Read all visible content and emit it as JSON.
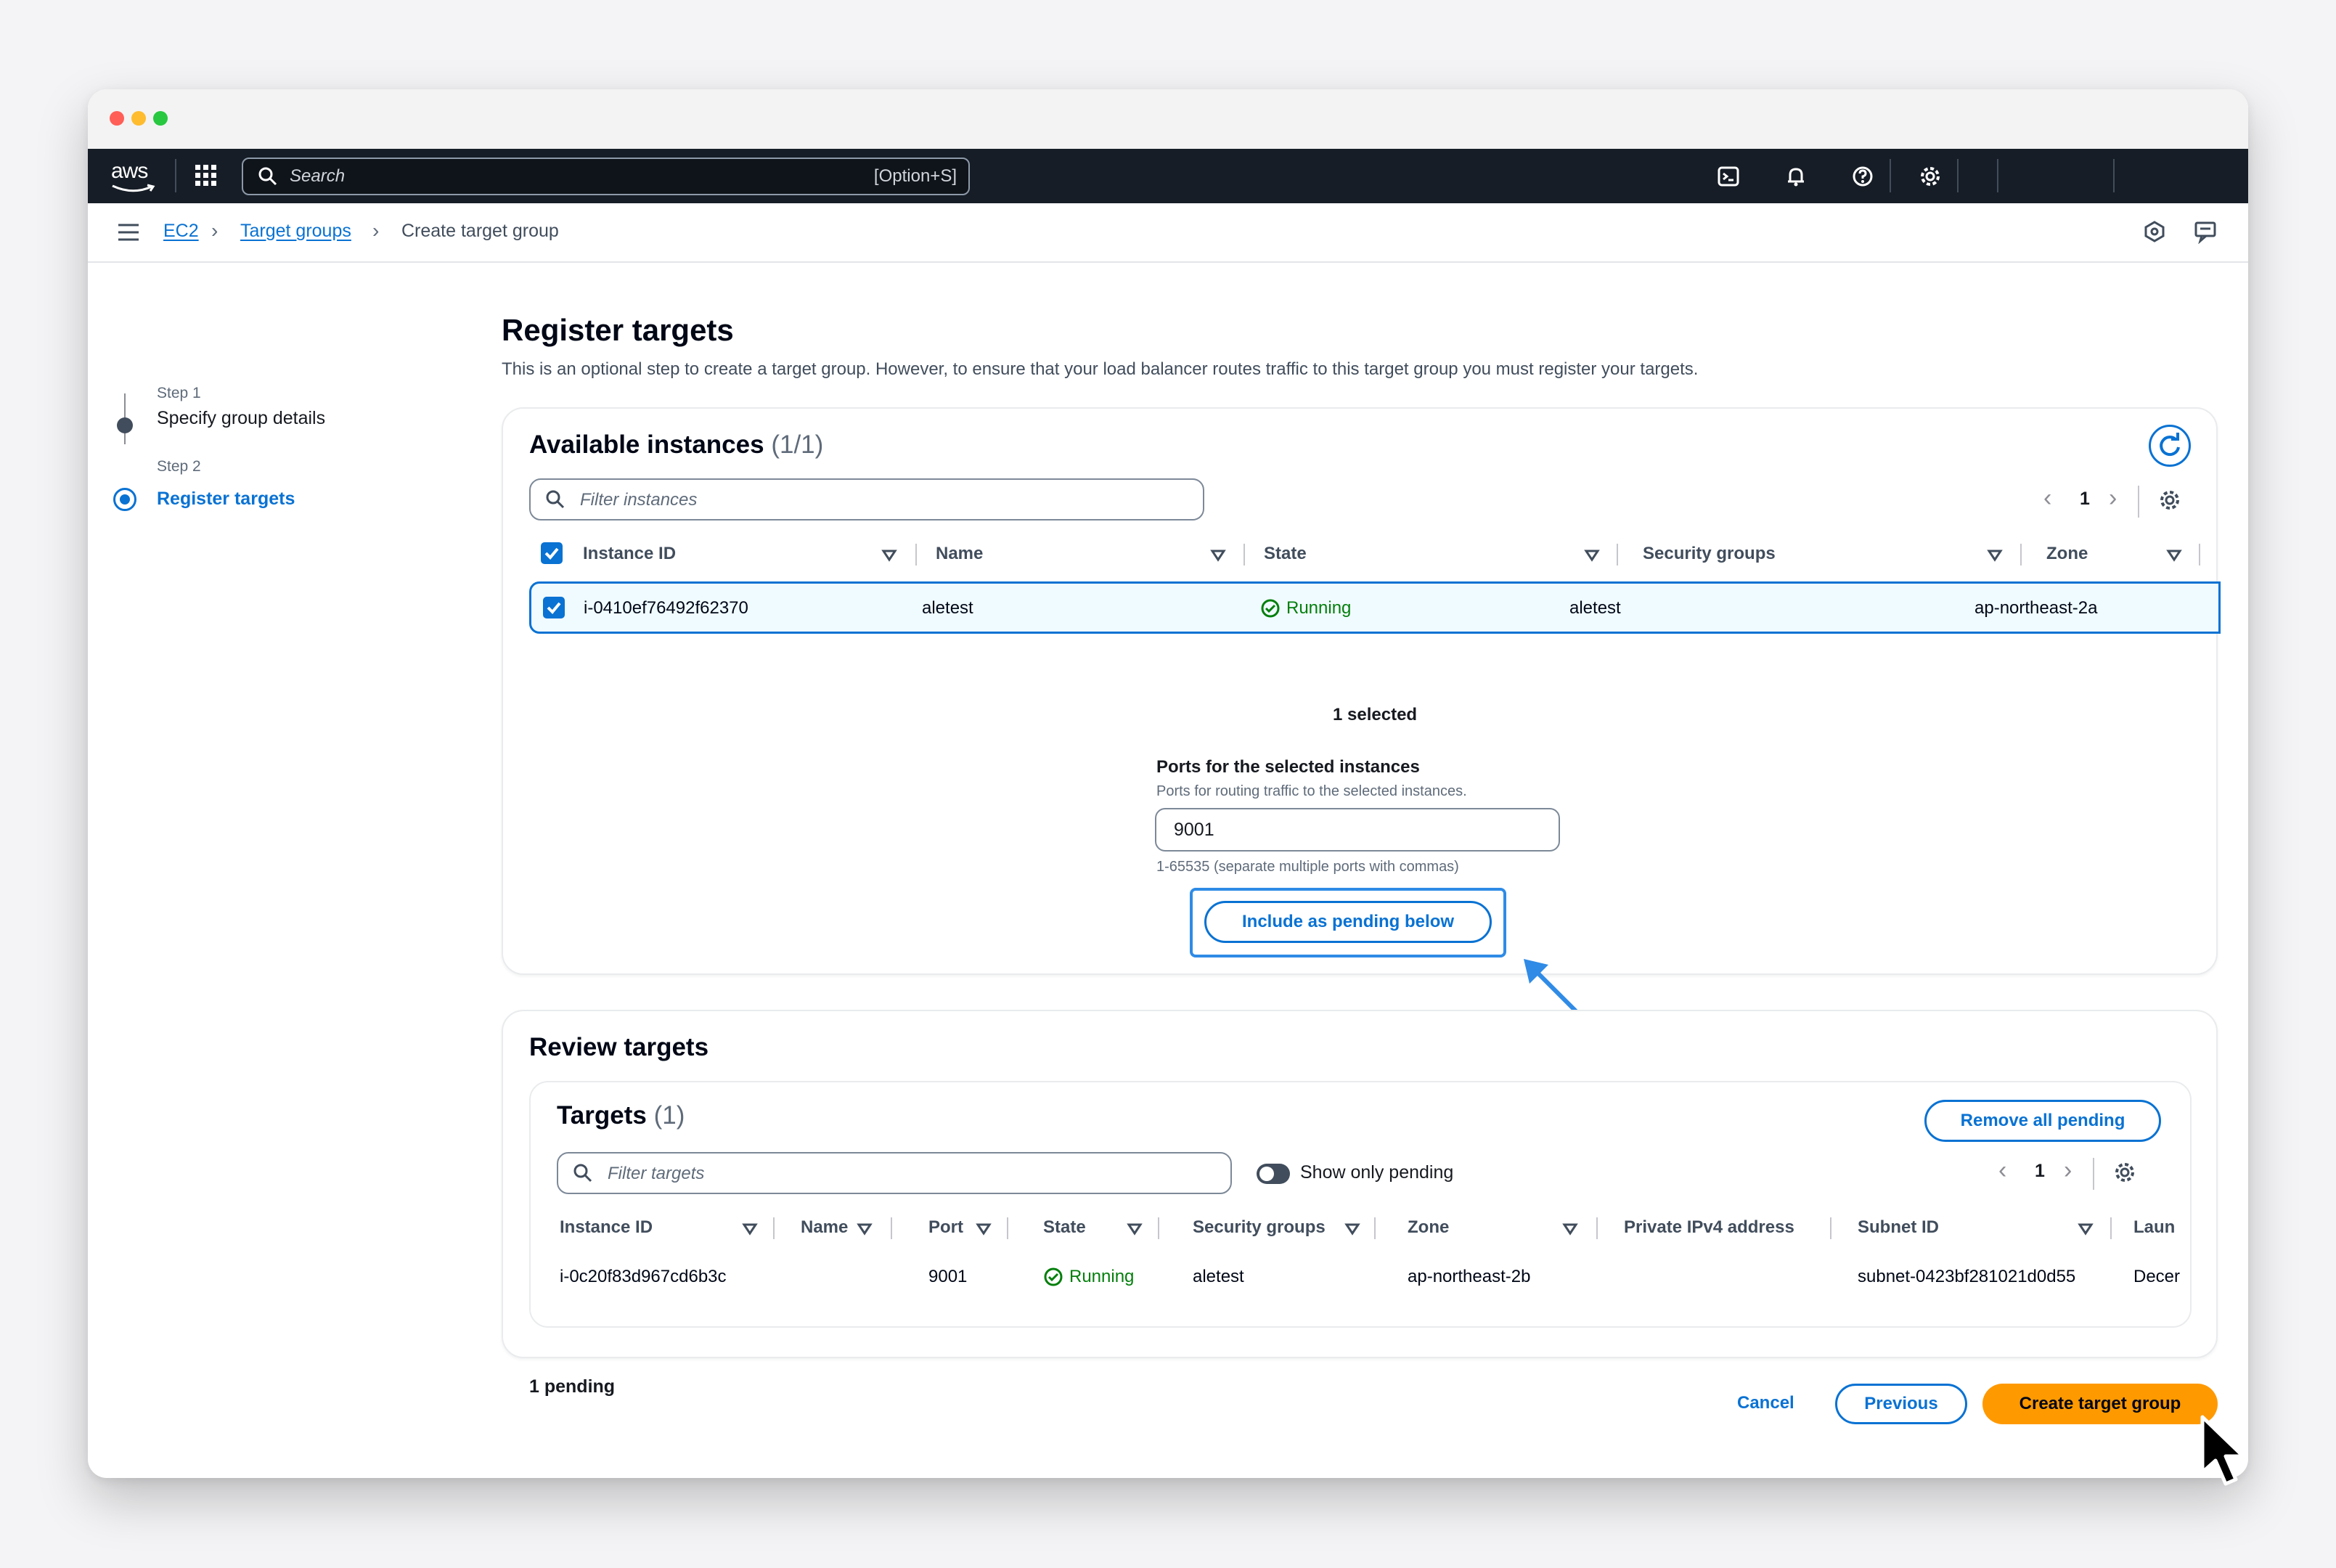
{
  "topnav": {
    "logo": "aws",
    "search_placeholder": "Search",
    "search_shortcut": "[Option+S]",
    "icons": [
      "cloudshell-icon",
      "bell-icon",
      "help-icon",
      "gear-icon"
    ]
  },
  "breadcrumb": {
    "items": [
      "EC2",
      "Target groups",
      "Create target group"
    ]
  },
  "steps": [
    {
      "step": "Step 1",
      "title": "Specify group details",
      "active": false
    },
    {
      "step": "Step 2",
      "title": "Register targets",
      "active": true
    }
  ],
  "page": {
    "title": "Register targets",
    "description": "This is an optional step to create a target group. However, to ensure that your load balancer routes traffic to this target group you must register your targets."
  },
  "available": {
    "title": "Available instances",
    "count": "(1/1)",
    "filter_placeholder": "Filter instances",
    "page": "1",
    "columns": [
      "Instance ID",
      "Name",
      "State",
      "Security groups",
      "Zone"
    ],
    "rows": [
      {
        "instance_id": "i-0410ef76492f62370",
        "name": "aletest",
        "state": "Running",
        "security_groups": "aletest",
        "zone": "ap-northeast-2a",
        "selected": true
      }
    ],
    "selected_text": "1 selected",
    "ports_label": "Ports for the selected instances",
    "ports_desc": "Ports for routing traffic to the selected instances.",
    "ports_value": "9001",
    "ports_hint": "1-65535 (separate multiple ports with commas)",
    "include_button": "Include as pending below"
  },
  "review": {
    "title": "Review targets",
    "targets_title": "Targets",
    "targets_count": "(1)",
    "remove_button": "Remove all pending",
    "filter_placeholder": "Filter targets",
    "toggle_label": "Show only pending",
    "page": "1",
    "columns": [
      "Instance ID",
      "Name",
      "Port",
      "State",
      "Security groups",
      "Zone",
      "Private IPv4 address",
      "Subnet ID",
      "Laun"
    ],
    "rows": [
      {
        "instance_id": "i-0c20f83d967cd6b3c",
        "name": "",
        "port": "9001",
        "state": "Running",
        "security_groups": "aletest",
        "zone": "ap-northeast-2b",
        "private_ip": "",
        "subnet_id": "subnet-0423bf281021d0d55",
        "launch": "Decer"
      }
    ]
  },
  "footer": {
    "pending_text": "1 pending",
    "cancel": "Cancel",
    "previous": "Previous",
    "create": "Create target group"
  },
  "colors": {
    "accent": "#0972d3",
    "primary_button": "#ff9900",
    "success": "#037f0c",
    "nav_bg": "#161d26"
  }
}
